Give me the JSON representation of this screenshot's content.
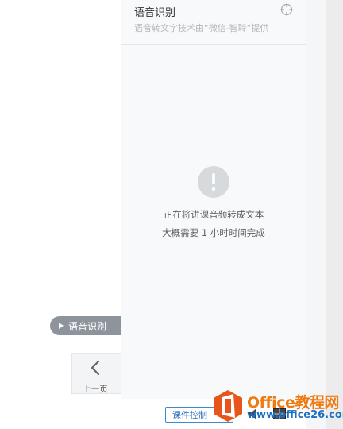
{
  "panel": {
    "title": "语音识别",
    "subtitle": "语音转文字技术由“微信-智聆”提供",
    "status_line1": "正在将讲课音频转成文本",
    "status_line2": "大概需要 1 小时时间完成"
  },
  "side_tab": {
    "label": "语音识别"
  },
  "nav": {
    "prev_label": "上一页"
  },
  "bottom_bar": {
    "course_control_label": "课件控制"
  },
  "watermark": {
    "brand": "Office教程网",
    "url": "www.office26.com"
  },
  "colors": {
    "accent": "#3a8ad6",
    "tab_bg": "#8e949c",
    "wm_orange": "#f07a12",
    "wm_blue": "#1d6fc1"
  },
  "icons": [
    "crosshair-icon",
    "exclamation-icon",
    "triangle-right-icon",
    "chevron-left-icon",
    "speaker-icon",
    "grid-icon",
    "office-logo-icon"
  ]
}
